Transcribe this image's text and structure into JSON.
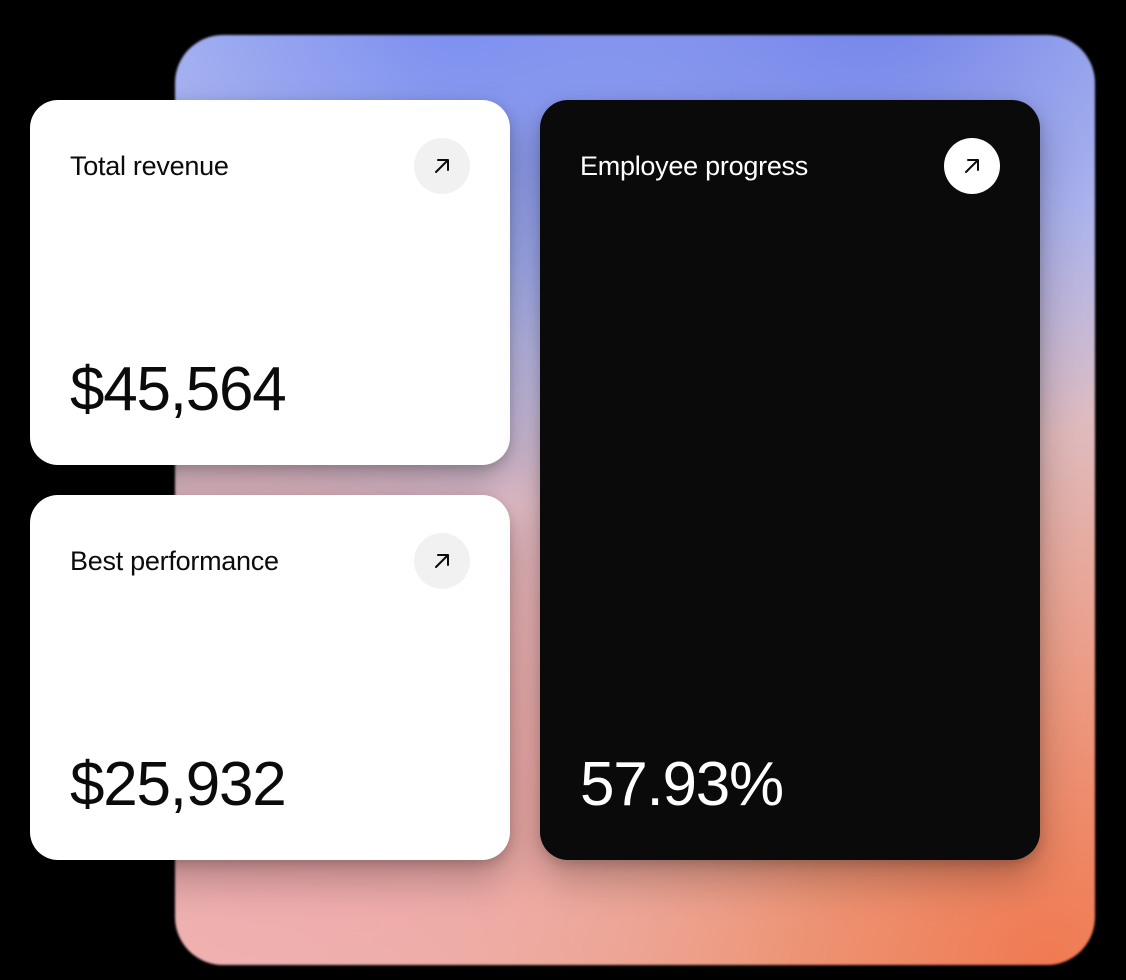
{
  "cards": {
    "revenue": {
      "title": "Total revenue",
      "value": "$45,564"
    },
    "performance": {
      "title": "Best performance",
      "value": "$25,932"
    },
    "progress": {
      "title": "Employee progress",
      "value": "57.93%"
    }
  }
}
